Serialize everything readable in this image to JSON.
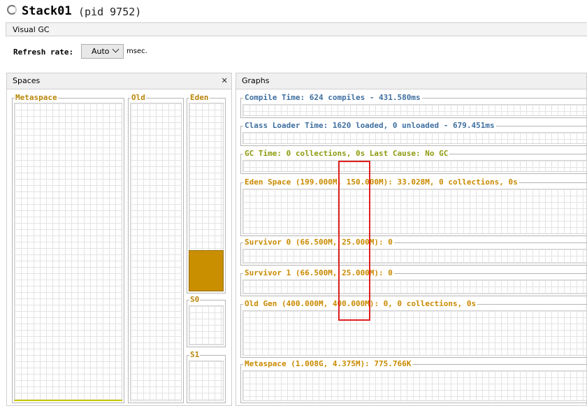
{
  "window": {
    "title": "Stack01",
    "pid": "(pid 9752)"
  },
  "tab": {
    "label": "Visual GC"
  },
  "refresh": {
    "label": "Refresh rate:",
    "value": "Auto",
    "unit": "msec."
  },
  "spaces": {
    "title": "Spaces",
    "close_symbol": "✕",
    "metaspace": {
      "label": "Metaspace",
      "fill": 0.0
    },
    "old": {
      "label": "Old",
      "fill": 0.0
    },
    "eden": {
      "label": "Eden",
      "fill": 0.22
    },
    "s0": {
      "label": "S0",
      "fill": 0.0
    },
    "s1": {
      "label": "S1",
      "fill": 0.0
    }
  },
  "graphs": {
    "title": "Graphs",
    "compile_time": "Compile Time: 624 compiles - 431.580ms",
    "class_loader": "Class Loader Time: 1620 loaded, 0 unloaded - 679.451ms",
    "gc_time": "GC Time: 0 collections, 0s Last Cause: No GC",
    "eden_space": "Eden Space (199.000M, 150.000M): 33.028M, 0 collections, 0s",
    "survivor0": "Survivor 0 (66.500M, 25.000M): 0",
    "survivor1": "Survivor 1 (66.500M, 25.000M): 0",
    "old_gen": "Old Gen (400.000M, 400.000M): 0, 0 collections, 0s",
    "metaspace": "Metaspace (1.008G, 4.375M): 775.766K"
  },
  "colors": {
    "accent_fill": "#c98f00",
    "highlight": "#e02020",
    "label_blue": "#3f6fa0",
    "label_olive": "#8f9a0f",
    "label_orange": "#c98a00"
  }
}
